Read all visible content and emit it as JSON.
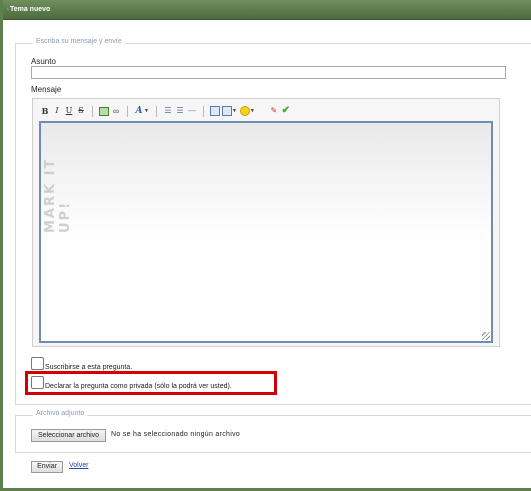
{
  "window": {
    "title": "Tema nuevo",
    "title_bullet": "∙"
  },
  "form": {
    "fieldset_legend": "Escriba su mensaje y envíe",
    "subject_label": "Asunto",
    "subject_value": "",
    "message_label": "Mensaje",
    "editor_watermark": "MARK IT UP!"
  },
  "toolbar": {
    "bold": "B",
    "italic": "I",
    "underline": "U",
    "strike": "S",
    "link": "∞",
    "font": "A",
    "caret": "▼",
    "list_bullets": "☰",
    "list_numbers": "☰",
    "hr": "—",
    "clean": "✎",
    "check": "✔"
  },
  "options": {
    "subscribe_label": "Suscribirse a esta pregunta.",
    "subscribe_checked": false,
    "private_label": "Declarar la pregunta como privada (sólo la podrá ver usted).",
    "private_checked": false,
    "highlight_color": "#d40000"
  },
  "attachment": {
    "legend": "Archivo adjunto",
    "button_label": "Seleccionar archivo",
    "status_text": "No se ha seleccionado ningún archivo"
  },
  "actions": {
    "submit_label": "Enviar",
    "back_label": "Volver"
  },
  "colors": {
    "title_bar": "#5f7f4f",
    "legend_text": "#8a9bb0",
    "editor_border": "#6d8db5"
  }
}
